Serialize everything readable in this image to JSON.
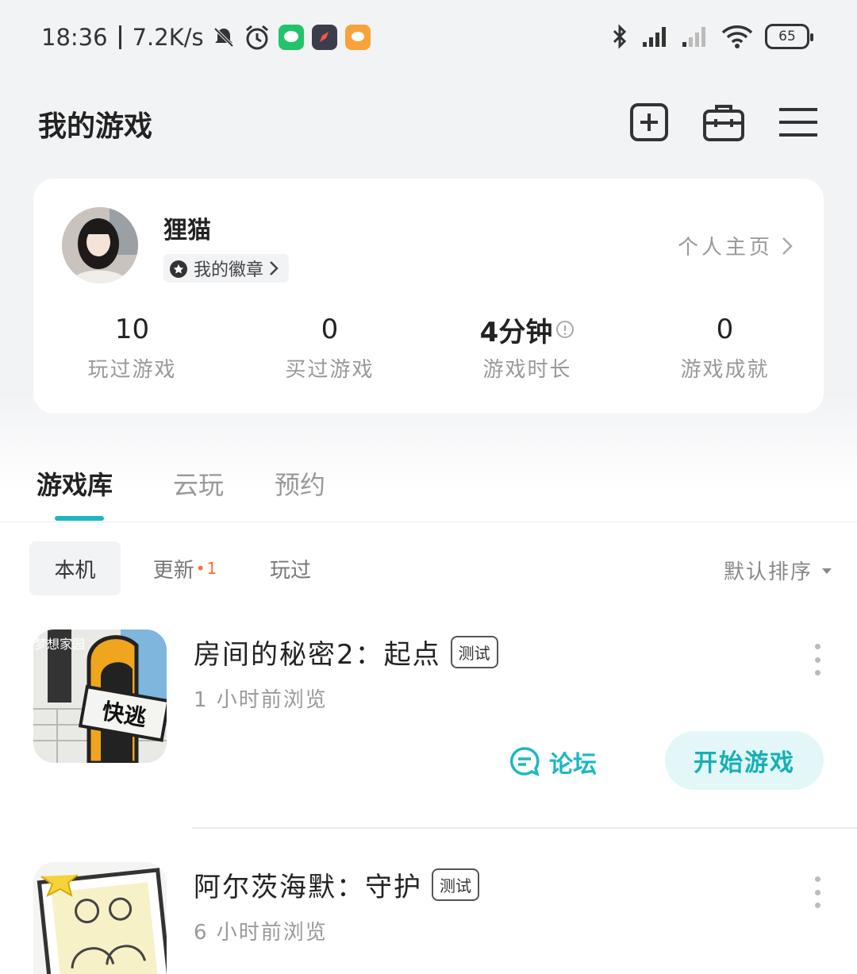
{
  "status_bar": {
    "time": "18:36",
    "speed": "7.2K/s",
    "battery": "65"
  },
  "header": {
    "title": "我的游戏"
  },
  "profile": {
    "username": "狸猫",
    "badge_label": "我的徽章",
    "home_link": "个人主页",
    "stats": [
      {
        "value": "10",
        "label": "玩过游戏"
      },
      {
        "value": "0",
        "label": "买过游戏"
      },
      {
        "value": "4分钟",
        "label": "游戏时长"
      },
      {
        "value": "0",
        "label": "游戏成就"
      }
    ]
  },
  "tabs": {
    "items": [
      "游戏库",
      "云玩",
      "预约"
    ],
    "active": 0
  },
  "filters": {
    "items": [
      {
        "label": "本机"
      },
      {
        "label": "更新",
        "dot": "•",
        "count": "1"
      },
      {
        "label": "玩过"
      }
    ],
    "sort_label": "默认排序"
  },
  "games": [
    {
      "title": "房间的秘密2：起点",
      "tag": "测试",
      "subtitle": "1 小时前浏览",
      "icon_text_1": "梦想家园",
      "icon_text_2": "快逃",
      "forum_label": "论坛",
      "play_label": "开始游戏"
    },
    {
      "title": "阿尔茨海默：守护",
      "tag": "测试",
      "subtitle": "6 小时前浏览"
    }
  ],
  "colors": {
    "accent": "#1cb8c0",
    "play_bg": "#e4f7f8",
    "update_dot": "#ff6a3a"
  }
}
